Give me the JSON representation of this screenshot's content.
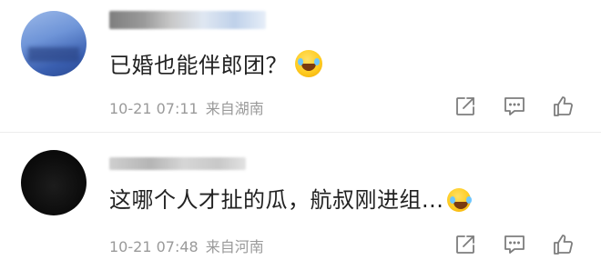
{
  "comments": [
    {
      "text": "已婚也能伴郎团？",
      "time": "10-21 07:11",
      "location": "来自湖南",
      "emoji": "laughing-tears-emoji"
    },
    {
      "text": "这哪个人才扯的瓜，航叔刚进组...",
      "time": "10-21 07:48",
      "location": "来自河南",
      "emoji": "laughing-tears-emoji"
    }
  ],
  "icons": {
    "share": "share-icon",
    "reply": "comment-icon",
    "like": "thumbs-up-icon"
  },
  "colors": {
    "text": "#222222",
    "meta": "#9a9a9a",
    "divider": "#ececec"
  }
}
